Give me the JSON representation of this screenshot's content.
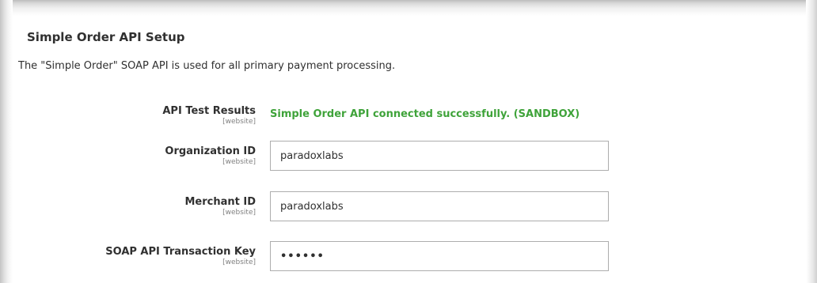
{
  "section": {
    "title": "Simple Order API Setup",
    "description": "The \"Simple Order\" SOAP API is used for all primary payment processing."
  },
  "fields": {
    "api_test_results": {
      "label": "API Test Results",
      "scope": "[website]",
      "status": "Simple Order API connected successfully. (SANDBOX)",
      "status_color": "#3fa33a"
    },
    "organization_id": {
      "label": "Organization ID",
      "scope": "[website]",
      "value": "paradoxlabs"
    },
    "merchant_id": {
      "label": "Merchant ID",
      "scope": "[website]",
      "value": "paradoxlabs"
    },
    "soap_api_transaction_key": {
      "label": "SOAP API Transaction Key",
      "scope": "[website]",
      "value": "••••••"
    }
  }
}
